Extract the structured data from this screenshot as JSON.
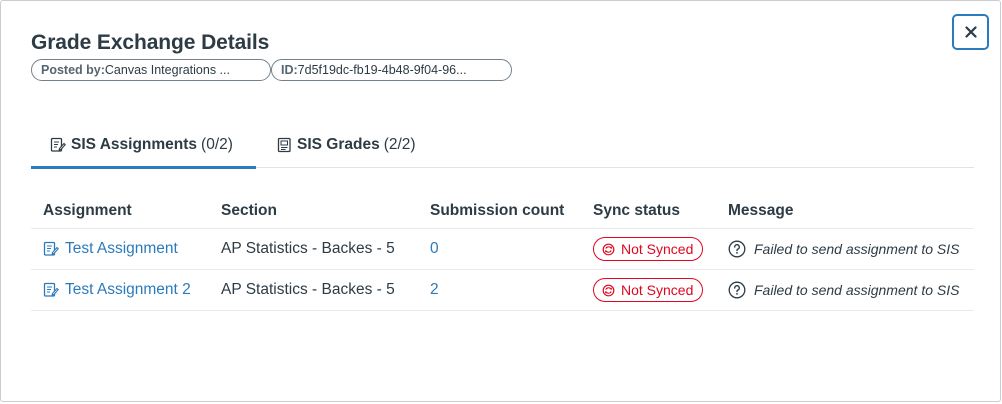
{
  "dialog": {
    "title": "Grade Exchange Details",
    "close_label": "×"
  },
  "pills": {
    "posted_label": "Posted by:",
    "posted_value": "Canvas Integrations ...",
    "id_label": "ID:",
    "id_value": "7d5f19dc-fb19-4b48-9f04-96..."
  },
  "tabs": [
    {
      "label": "SIS Assignments",
      "count": "(0/2)",
      "icon": "assignment-icon",
      "active": true
    },
    {
      "label": "SIS Grades",
      "count": "(2/2)",
      "icon": "gradebook-icon",
      "active": false
    }
  ],
  "table": {
    "headers": [
      "Assignment",
      "Section",
      "Submission count",
      "Sync status",
      "Message"
    ],
    "rows": [
      {
        "assignment": "Test Assignment",
        "section": "AP Statistics - Backes - 5",
        "submission_count": "0",
        "sync_status": "Not Synced",
        "message": "Failed to send assignment to SIS"
      },
      {
        "assignment": "Test Assignment 2",
        "section": "AP Statistics - Backes - 5",
        "submission_count": "2",
        "sync_status": "Not Synced",
        "message": "Failed to send assignment to SIS"
      }
    ]
  },
  "colors": {
    "link": "#2b7abc",
    "error": "#e0061f",
    "text": "#2d3b45",
    "border": "#c7cdd1"
  }
}
